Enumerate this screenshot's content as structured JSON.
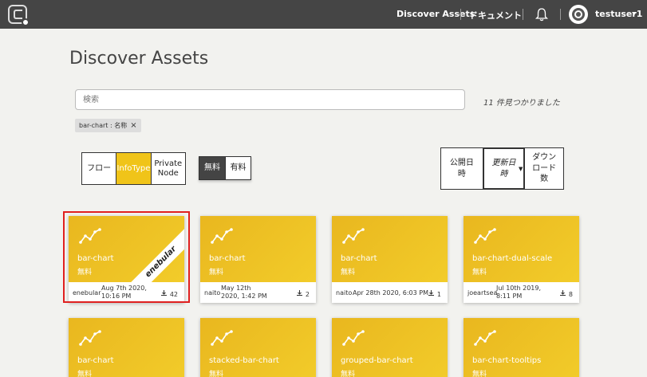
{
  "header": {
    "discover_label": "Discover Assets",
    "docs_label": "ドキュメント",
    "user_name": "testuser1"
  },
  "page": {
    "title": "Discover Assets",
    "search_placeholder": "検索",
    "result_count": "11 件見つかりました",
    "filter_tag": "bar-chart : 名称",
    "filter_tag_close": "×"
  },
  "type_filter": [
    "フロー",
    "InfoType",
    "Private Node"
  ],
  "type_filter_selected": "InfoType",
  "price_filter": [
    "無料",
    "有料"
  ],
  "price_filter_selected": "無料",
  "sort": [
    "公開日時",
    "更新日時",
    "ダウンロード数"
  ],
  "sort_selected": "更新日時",
  "cards": [
    {
      "name": "bar-chart",
      "price": "無料",
      "author": "enebular",
      "date": "Aug 7th 2020, 10:16 PM",
      "downloads": "42",
      "ribbon": "enebular"
    },
    {
      "name": "bar-chart",
      "price": "無料",
      "author": "naito",
      "date": "May 12th 2020, 1:42 PM",
      "downloads": "2"
    },
    {
      "name": "bar-chart",
      "price": "無料",
      "author": "naito",
      "date": "Apr 28th 2020, 6:03 PM",
      "downloads": "1"
    },
    {
      "name": "bar-chart-dual-scale",
      "price": "無料",
      "author": "joeartsea",
      "date": "Jul 10th 2019, 8:11 PM",
      "downloads": "8"
    },
    {
      "name": "bar-chart",
      "price": "無料"
    },
    {
      "name": "stacked-bar-chart",
      "price": "無料"
    },
    {
      "name": "grouped-bar-chart",
      "price": "無料"
    },
    {
      "name": "bar-chart-tooltips",
      "price": "無料"
    }
  ],
  "colors": {
    "header_bg": "#454545",
    "accent": "#f0c419",
    "highlight": "#e02020"
  },
  "icons": [
    "logo-icon",
    "bell-icon",
    "avatar-icon",
    "chart-line-icon",
    "download-icon",
    "close-icon",
    "chevron-down-icon"
  ]
}
